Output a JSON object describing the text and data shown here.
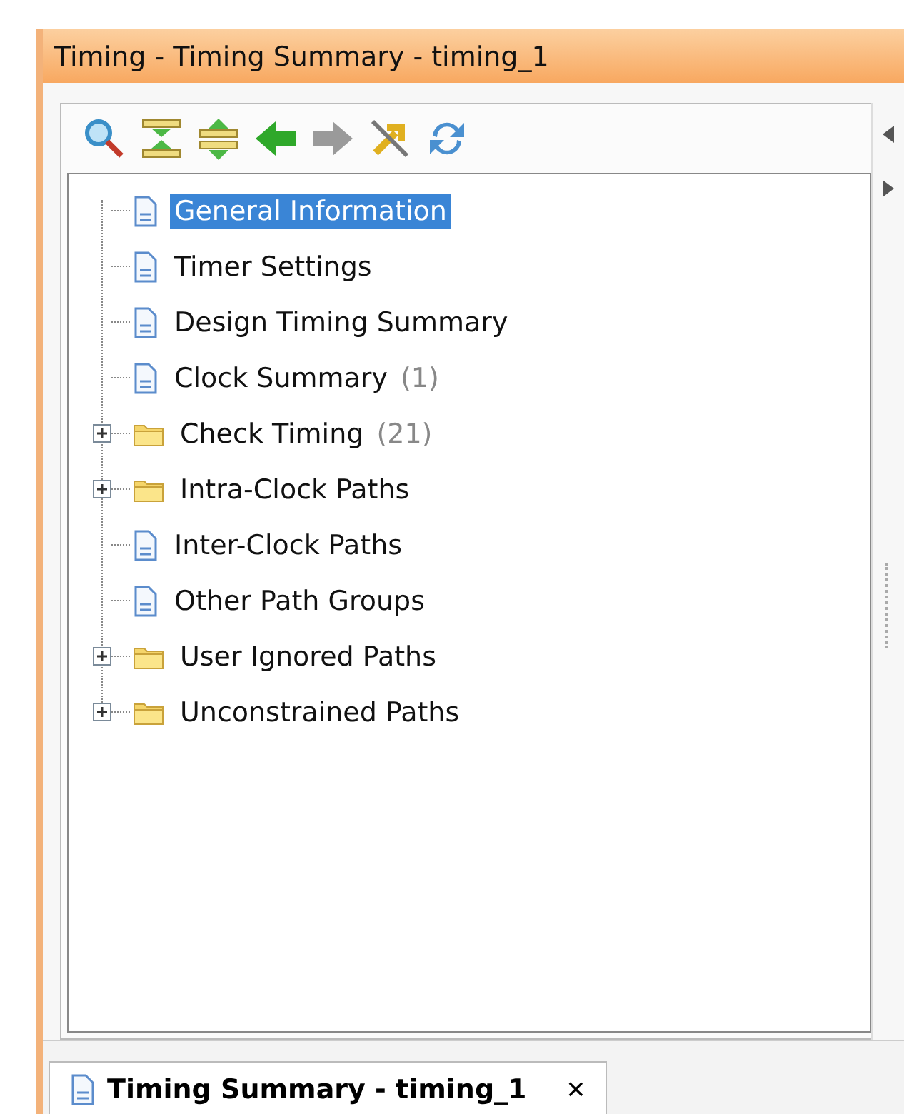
{
  "window": {
    "title": "Timing - Timing Summary - timing_1"
  },
  "tree": [
    {
      "kind": "doc",
      "label": "General Information",
      "selected": true
    },
    {
      "kind": "doc",
      "label": "Timer Settings",
      "selected": false
    },
    {
      "kind": "doc",
      "label": "Design Timing Summary",
      "selected": false
    },
    {
      "kind": "doc",
      "label": "Clock Summary",
      "count": "(1)",
      "selected": false
    },
    {
      "kind": "folder",
      "label": "Check Timing",
      "count": "(21)",
      "selected": false,
      "expanded": false
    },
    {
      "kind": "folder",
      "label": "Intra-Clock Paths",
      "selected": false,
      "expanded": false
    },
    {
      "kind": "doc",
      "label": "Inter-Clock Paths",
      "selected": false
    },
    {
      "kind": "doc",
      "label": "Other Path Groups",
      "selected": false
    },
    {
      "kind": "folder",
      "label": "User Ignored Paths",
      "selected": false,
      "expanded": false
    },
    {
      "kind": "folder",
      "label": "Unconstrained Paths",
      "selected": false,
      "expanded": false
    }
  ],
  "bottom_tab": {
    "label": "Timing Summary - timing_1",
    "close": "×"
  }
}
